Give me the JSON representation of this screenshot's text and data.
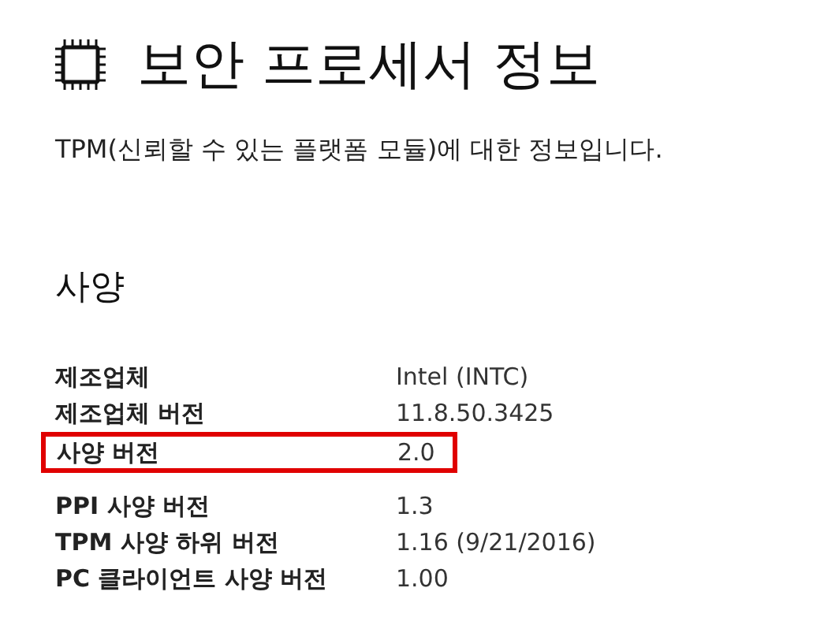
{
  "header": {
    "title": "보안 프로세서 정보",
    "description": "TPM(신뢰할 수 있는 플랫폼 모듈)에 대한 정보입니다."
  },
  "specs": {
    "heading": "사양",
    "groups": [
      {
        "rows": [
          {
            "label": "제조업체",
            "value": "Intel (INTC)",
            "highlighted": false
          },
          {
            "label": "제조업체 버전",
            "value": "11.8.50.3425",
            "highlighted": false
          },
          {
            "label": "사양 버전",
            "value": "2.0",
            "highlighted": true
          }
        ]
      },
      {
        "rows": [
          {
            "label": "PPI 사양 버전",
            "value": "1.3",
            "highlighted": false
          },
          {
            "label": "TPM 사양 하위 버전",
            "value": "1.16 (9/21/2016)",
            "highlighted": false
          },
          {
            "label": "PC 클라이언트 사양 버전",
            "value": "1.00",
            "highlighted": false
          }
        ]
      }
    ]
  }
}
